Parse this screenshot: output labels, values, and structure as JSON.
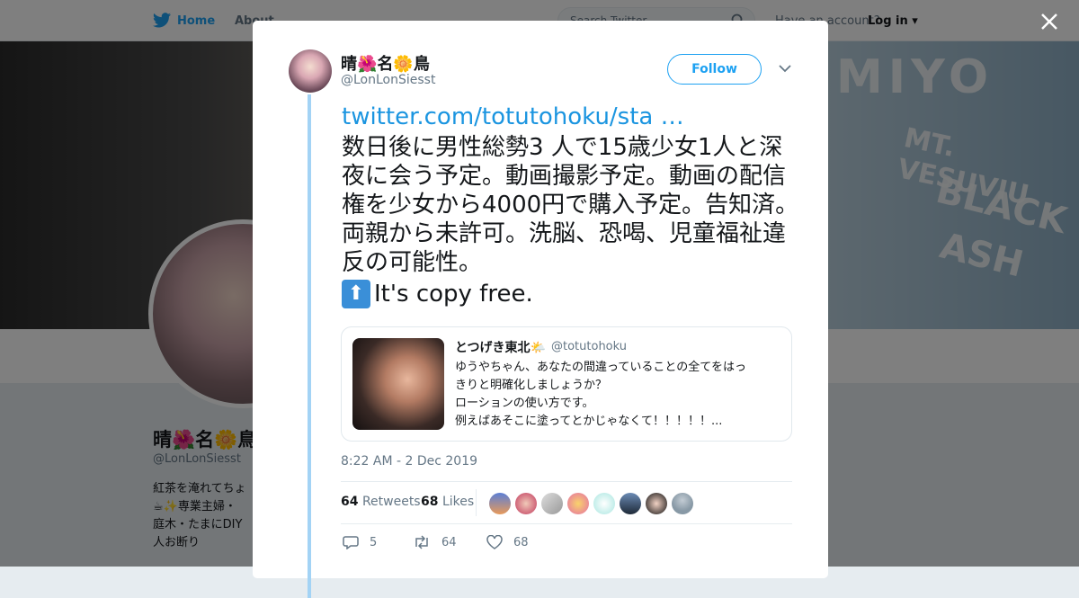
{
  "topnav": {
    "home": "Home",
    "about": "About",
    "search_placeholder": "Search Twitter",
    "have_account": "Have an account?",
    "login": "Log in"
  },
  "banner": {
    "text1": "MIYO",
    "text2": "MT. VESUVIU",
    "text3": "BLACK",
    "text4": "ASH"
  },
  "profile": {
    "name": "晴🌺名🌼鳥",
    "handle": "@LonLonSiesst",
    "bio_lines": [
      "紅茶を淹れてちょ",
      "☕✨専業主婦・",
      "庭木・たまにDIY",
      "人お断り"
    ]
  },
  "tweet": {
    "author_name": "晴🌺名🌼鳥",
    "author_handle": "@LonLonSiesst",
    "follow_label": "Follow",
    "link": "twitter.com/totutohoku/sta …",
    "text": "数日後に男性総勢3 人で15歳少女1人と深夜に会う予定。動画撮影予定。動画の配信権を少女から4000円で購入予定。告知済。両親から未許可。洗脳、恐喝、児童福祉違反の可能性。",
    "extra": "It's copy free.",
    "timestamp": "8:22 AM - 2 Dec 2019",
    "retweets_count": "64",
    "retweets_label": "Retweets",
    "likes_count": "68",
    "likes_label": "Likes",
    "reply_count": "5",
    "retweet_action_count": "64",
    "like_action_count": "68"
  },
  "quote": {
    "name": "とつげき東北🌤️",
    "handle": "@totutohoku",
    "lines": [
      "ゆうやちゃん、あなたの間違っていることの全てをはっ",
      "きりと明確化しましょうか？",
      "ローションの使い方です。",
      "例えばあそこに塗ってとかじゃなくて！！！！！..."
    ]
  },
  "colors": {
    "accent": "#1da1f2",
    "link": "#1b95e0",
    "thread_line": "#a3d3f5",
    "muted": "#657786"
  }
}
